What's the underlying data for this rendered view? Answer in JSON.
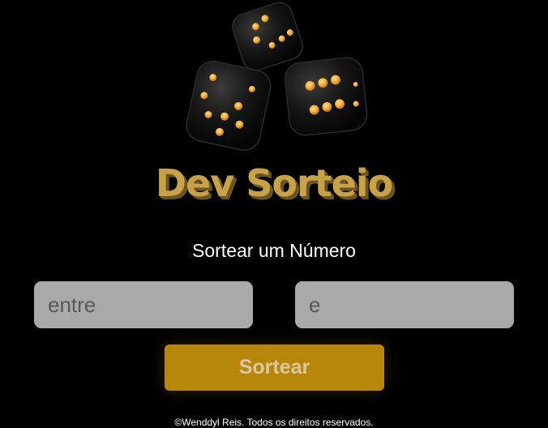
{
  "brand": {
    "title": "Dev Sorteio",
    "logo_icon": "dice-icon"
  },
  "colors": {
    "background": "#000000",
    "accent": "#b8860b",
    "brand_gold": "#c8a24a",
    "input_bg": "#a9a9a9",
    "pip": "#f2a93b"
  },
  "form": {
    "heading": "Sortear um Número",
    "min_placeholder": "entre",
    "max_placeholder": "e",
    "submit_label": "Sortear"
  },
  "footer": {
    "text": "©Wenddyl Reis. Todos os direitos reservados."
  }
}
